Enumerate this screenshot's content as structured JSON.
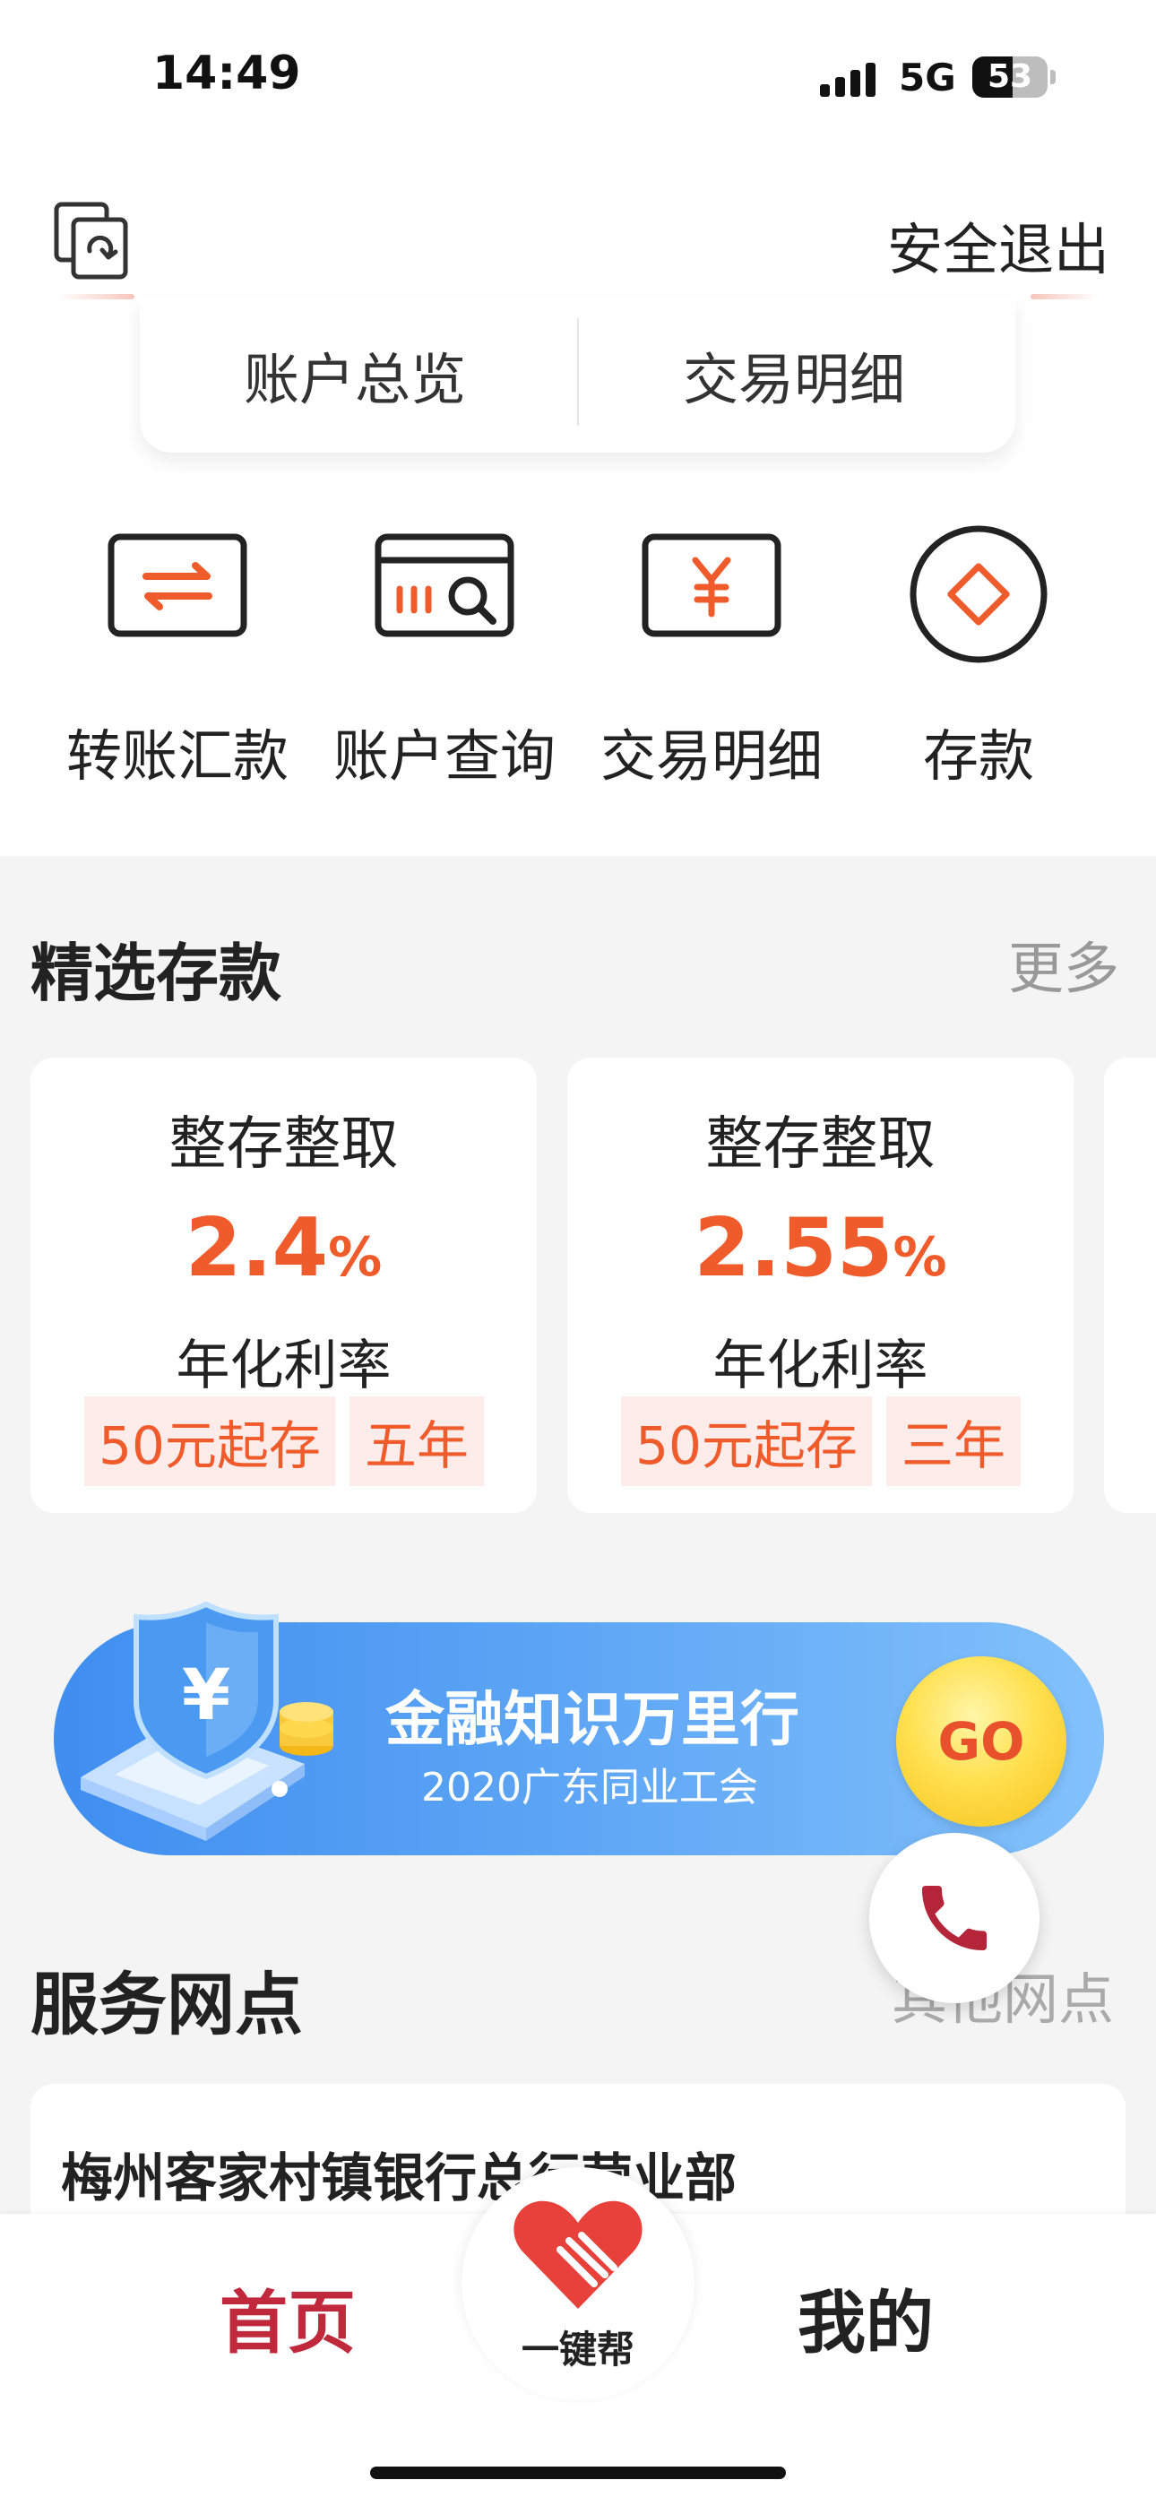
{
  "status_bar": {
    "time": "14:49",
    "network": "5G",
    "battery": "53",
    "battery_level": 0.53
  },
  "header": {
    "logout_label": "安全退出"
  },
  "top_tabs": [
    {
      "label": "账户总览"
    },
    {
      "label": "交易明细"
    }
  ],
  "shortcuts": [
    {
      "label": "转账汇款",
      "icon": "transfer-icon"
    },
    {
      "label": "账户查询",
      "icon": "account-query-icon"
    },
    {
      "label": "交易明细",
      "icon": "yuan-card-icon"
    },
    {
      "label": "存款",
      "icon": "deposit-diamond-icon"
    }
  ],
  "deposits": {
    "title": "精选存款",
    "more_label": "更多",
    "items": [
      {
        "name": "整存整取",
        "rate": "2.4",
        "rate_unit": "%",
        "rate_label": "年化利率",
        "min_tag": "50元起存",
        "term_tag": "五年"
      },
      {
        "name": "整存整取",
        "rate": "2.55",
        "rate_unit": "%",
        "rate_label": "年化利率",
        "min_tag": "50元起存",
        "term_tag": "三年"
      }
    ]
  },
  "banner": {
    "title": "金融知识万里行",
    "subtitle": "2020广东同业工会",
    "go_label": "GO",
    "shield_glyph": "¥"
  },
  "outlets": {
    "title": "服务网点",
    "more_label": "其他网点",
    "first_name": "梅州客家村镇银行总行营业部"
  },
  "bottom_nav": {
    "home_label": "首页",
    "help_label": "一键帮",
    "mine_label": "我的"
  },
  "colors": {
    "accent_orange": "#f05b2b",
    "brand_red": "#c0283b",
    "banner_blue": "#4f9bf2"
  }
}
